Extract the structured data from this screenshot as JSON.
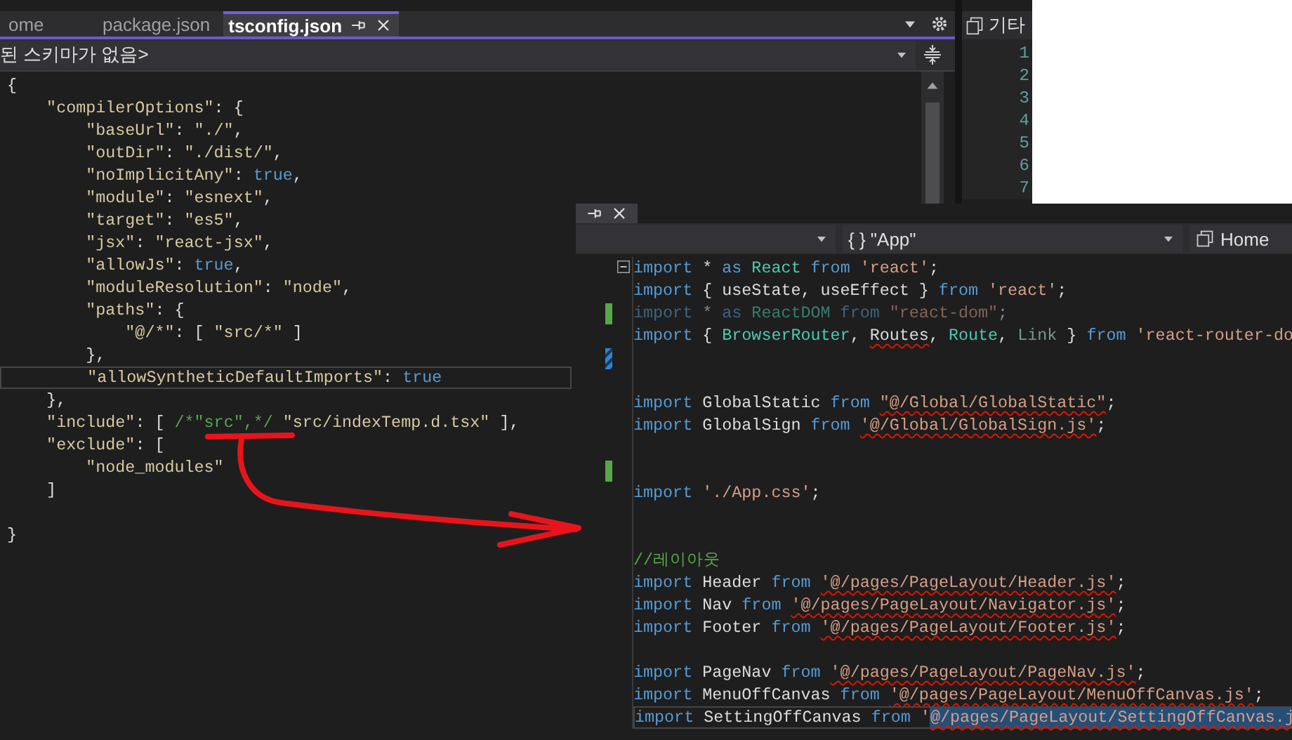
{
  "left_editor": {
    "tabs": [
      {
        "label": "ome",
        "selected": false
      },
      {
        "label": "package.json",
        "selected": false
      },
      {
        "label": "tsconfig.json",
        "selected": true
      }
    ],
    "schema": "된 스키마가 없음>",
    "lines": [
      {
        "tokens": [
          {
            "text": "{",
            "kind": "punct"
          }
        ]
      },
      {
        "tokens": [
          {
            "text": "    \"compilerOptions\"",
            "kind": "key"
          },
          {
            "text": ": {",
            "kind": "punct"
          }
        ]
      },
      {
        "tokens": [
          {
            "text": "        \"baseUrl\"",
            "kind": "key"
          },
          {
            "text": ": ",
            "kind": "punct"
          },
          {
            "text": "\"./\"",
            "kind": "value"
          },
          {
            "text": ",",
            "kind": "punct"
          }
        ]
      },
      {
        "tokens": [
          {
            "text": "        \"outDir\"",
            "kind": "key"
          },
          {
            "text": ": ",
            "kind": "punct"
          },
          {
            "text": "\"./dist/\"",
            "kind": "value"
          },
          {
            "text": ",",
            "kind": "punct"
          }
        ]
      },
      {
        "tokens": [
          {
            "text": "        \"noImplicitAny\"",
            "kind": "key"
          },
          {
            "text": ": ",
            "kind": "punct"
          },
          {
            "text": "true",
            "kind": "literal"
          },
          {
            "text": ",",
            "kind": "punct"
          }
        ]
      },
      {
        "tokens": [
          {
            "text": "        \"module\"",
            "kind": "key"
          },
          {
            "text": ": ",
            "kind": "punct"
          },
          {
            "text": "\"esnext\"",
            "kind": "value"
          },
          {
            "text": ",",
            "kind": "punct"
          }
        ]
      },
      {
        "tokens": [
          {
            "text": "        \"target\"",
            "kind": "key"
          },
          {
            "text": ": ",
            "kind": "punct"
          },
          {
            "text": "\"es5\"",
            "kind": "value"
          },
          {
            "text": ",",
            "kind": "punct"
          }
        ]
      },
      {
        "tokens": [
          {
            "text": "        \"jsx\"",
            "kind": "key"
          },
          {
            "text": ": ",
            "kind": "punct"
          },
          {
            "text": "\"react-jsx\"",
            "kind": "value"
          },
          {
            "text": ",",
            "kind": "punct"
          }
        ]
      },
      {
        "tokens": [
          {
            "text": "        \"allowJs\"",
            "kind": "key"
          },
          {
            "text": ": ",
            "kind": "punct"
          },
          {
            "text": "true",
            "kind": "literal"
          },
          {
            "text": ",",
            "kind": "punct"
          }
        ]
      },
      {
        "tokens": [
          {
            "text": "        \"moduleResolution\"",
            "kind": "key"
          },
          {
            "text": ": ",
            "kind": "punct"
          },
          {
            "text": "\"node\"",
            "kind": "value"
          },
          {
            "text": ",",
            "kind": "punct"
          }
        ]
      },
      {
        "tokens": [
          {
            "text": "        \"paths\"",
            "kind": "key"
          },
          {
            "text": ": {",
            "kind": "punct"
          }
        ]
      },
      {
        "tokens": [
          {
            "text": "            \"@/*\"",
            "kind": "key"
          },
          {
            "text": ": [ ",
            "kind": "punct"
          },
          {
            "text": "\"src/*\"",
            "kind": "value"
          },
          {
            "text": " ]",
            "kind": "punct"
          }
        ]
      },
      {
        "tokens": [
          {
            "text": "        },",
            "kind": "punct"
          }
        ]
      },
      {
        "boxed": true,
        "tokens": [
          {
            "text": "        \"allowSyntheticDefaultImports\"",
            "kind": "key"
          },
          {
            "text": ": ",
            "kind": "punct"
          },
          {
            "text": "true",
            "kind": "literal"
          }
        ]
      },
      {
        "tokens": [
          {
            "text": "    },",
            "kind": "punct"
          }
        ]
      },
      {
        "tokens": [
          {
            "text": "    \"include\"",
            "kind": "key"
          },
          {
            "text": ": [ ",
            "kind": "punct"
          },
          {
            "text": "/*\"src\",*/",
            "kind": "comment"
          },
          {
            "text": " \"src/indexTemp.d.tsx\"",
            "kind": "value"
          },
          {
            "text": " ],",
            "kind": "punct"
          }
        ]
      },
      {
        "tokens": [
          {
            "text": "    \"exclude\"",
            "kind": "key"
          },
          {
            "text": ": [",
            "kind": "punct"
          }
        ]
      },
      {
        "tokens": [
          {
            "text": "        \"node_modules\"",
            "kind": "value"
          }
        ]
      },
      {
        "tokens": [
          {
            "text": "    ]",
            "kind": "punct"
          }
        ]
      },
      {
        "blank": true
      },
      {
        "tokens": [
          {
            "text": "}",
            "kind": "punct"
          }
        ]
      }
    ]
  },
  "side_panel": {
    "tab": "기타",
    "line_numbers": [
      "1",
      "2",
      "3",
      "4",
      "5",
      "6",
      "7"
    ]
  },
  "overlay_editor": {
    "scope": "{ } \"App\"",
    "member": "Home",
    "lines": [
      {
        "collapsible": true,
        "tokens": [
          {
            "text": "import",
            "kind": "keyword"
          },
          {
            "text": " *",
            "kind": "punct"
          },
          {
            "text": " as",
            "kind": "keyword"
          },
          {
            "text": " React",
            "kind": "type"
          },
          {
            "text": " from",
            "kind": "keyword"
          },
          {
            "text": " 'react'",
            "kind": "string"
          },
          {
            "text": ";",
            "kind": "punct"
          }
        ]
      },
      {
        "tokens": [
          {
            "text": "import",
            "kind": "keyword"
          },
          {
            "text": " { useState, useEffect }",
            "kind": "punct"
          },
          {
            "text": " from",
            "kind": "keyword"
          },
          {
            "text": " 'react'",
            "kind": "string"
          },
          {
            "text": ";",
            "kind": "punct"
          }
        ]
      },
      {
        "added": true,
        "faded": true,
        "tokens": [
          {
            "text": "import",
            "kind": "keyword"
          },
          {
            "text": " *",
            "kind": "punct"
          },
          {
            "text": " as",
            "kind": "keyword"
          },
          {
            "text": " ReactDOM",
            "kind": "type"
          },
          {
            "text": " from",
            "kind": "keyword"
          },
          {
            "text": " \"react-dom\"",
            "kind": "string"
          },
          {
            "text": ";",
            "kind": "punct"
          }
        ]
      },
      {
        "tokens": [
          {
            "text": "import",
            "kind": "keyword"
          },
          {
            "text": " { ",
            "kind": "punct"
          },
          {
            "text": "BrowserRouter",
            "kind": "type"
          },
          {
            "text": ", ",
            "kind": "punct"
          },
          {
            "text": "Routes",
            "kind": "punct",
            "squiggle": true
          },
          {
            "text": ", ",
            "kind": "punct"
          },
          {
            "text": "Route",
            "kind": "type"
          },
          {
            "text": ", ",
            "kind": "punct"
          },
          {
            "text": "Link",
            "kind": "unused"
          },
          {
            "text": " }",
            "kind": "punct"
          },
          {
            "text": " from",
            "kind": "keyword"
          },
          {
            "text": " 'react-router-do",
            "kind": "string"
          }
        ]
      },
      {
        "edited": true,
        "blank": true
      },
      {
        "blank": true
      },
      {
        "tokens": [
          {
            "text": "import",
            "kind": "keyword"
          },
          {
            "text": " GlobalStatic",
            "kind": "punct"
          },
          {
            "text": " from ",
            "kind": "keyword"
          },
          {
            "text": "\"@/Global/GlobalStatic\"",
            "kind": "string",
            "squiggle": true
          },
          {
            "text": ";",
            "kind": "punct"
          }
        ]
      },
      {
        "tokens": [
          {
            "text": "import",
            "kind": "keyword"
          },
          {
            "text": " GlobalSign",
            "kind": "punct"
          },
          {
            "text": " from ",
            "kind": "keyword"
          },
          {
            "text": "'@/Global/GlobalSign.js'",
            "kind": "string",
            "squiggle": true
          },
          {
            "text": ";",
            "kind": "punct"
          }
        ]
      },
      {
        "blank": true
      },
      {
        "added": true,
        "blank": true
      },
      {
        "tokens": [
          {
            "text": "import",
            "kind": "keyword"
          },
          {
            "text": " './App.css'",
            "kind": "string"
          },
          {
            "text": ";",
            "kind": "punct"
          }
        ]
      },
      {
        "blank": true
      },
      {
        "blank": true
      },
      {
        "tokens": [
          {
            "text": "//레이아웃",
            "kind": "comment"
          }
        ]
      },
      {
        "tokens": [
          {
            "text": "import",
            "kind": "keyword"
          },
          {
            "text": " Header",
            "kind": "punct"
          },
          {
            "text": " from ",
            "kind": "keyword"
          },
          {
            "text": "'@/pages/PageLayout/Header.js'",
            "kind": "string",
            "squiggle": true
          },
          {
            "text": ";",
            "kind": "punct"
          }
        ]
      },
      {
        "tokens": [
          {
            "text": "import",
            "kind": "keyword"
          },
          {
            "text": " Nav",
            "kind": "punct"
          },
          {
            "text": " from ",
            "kind": "keyword"
          },
          {
            "text": "'@/pages/PageLayout/Navigator.js'",
            "kind": "string",
            "squiggle": true
          },
          {
            "text": ";",
            "kind": "punct"
          }
        ]
      },
      {
        "tokens": [
          {
            "text": "import",
            "kind": "keyword"
          },
          {
            "text": " Footer",
            "kind": "punct"
          },
          {
            "text": " from ",
            "kind": "keyword"
          },
          {
            "text": "'@/pages/PageLayout/Footer.js'",
            "kind": "string",
            "squiggle": true
          },
          {
            "text": ";",
            "kind": "punct"
          }
        ]
      },
      {
        "blank": true
      },
      {
        "tokens": [
          {
            "text": "import",
            "kind": "keyword"
          },
          {
            "text": " PageNav",
            "kind": "punct"
          },
          {
            "text": " from ",
            "kind": "keyword"
          },
          {
            "text": "'@/pages/PageLayout/PageNav.js'",
            "kind": "string",
            "squiggle": true
          },
          {
            "text": ";",
            "kind": "punct"
          }
        ]
      },
      {
        "tokens": [
          {
            "text": "import",
            "kind": "keyword"
          },
          {
            "text": " MenuOffCanvas",
            "kind": "punct"
          },
          {
            "text": " from ",
            "kind": "keyword"
          },
          {
            "text": "'@/pages/PageLayout/MenuOffCanvas.js'",
            "kind": "string",
            "squiggle": true
          },
          {
            "text": ";",
            "kind": "punct"
          }
        ]
      },
      {
        "boxed": true,
        "tokens": [
          {
            "text": "import",
            "kind": "keyword",
            "selected": false
          },
          {
            "text": " SettingOffCanvas",
            "kind": "punct",
            "selected": false
          },
          {
            "text": " from",
            "kind": "keyword",
            "selected": false
          },
          {
            "text": " '",
            "kind": "string",
            "selected": false
          },
          {
            "text": "@/pages/PageLayout/SettingOffCanvas.j",
            "kind": "string",
            "squiggle": true,
            "selected": true
          }
        ]
      }
    ]
  }
}
